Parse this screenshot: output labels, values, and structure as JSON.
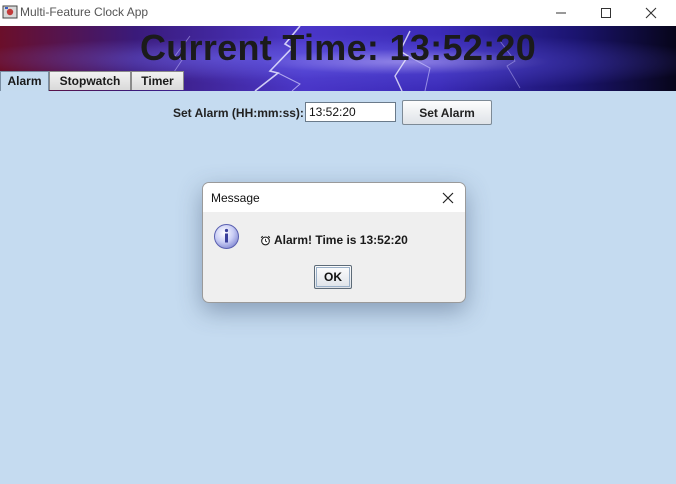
{
  "window": {
    "title": "Multi-Feature Clock App",
    "icons": [
      "app-icon",
      "minimize-icon",
      "maximize-icon",
      "close-icon"
    ]
  },
  "banner": {
    "time_text": "Current Time: 13:52:20",
    "background": "lightning-storm"
  },
  "tabs": [
    {
      "label": "Alarm",
      "active": true
    },
    {
      "label": "Stopwatch",
      "active": false
    },
    {
      "label": "Timer",
      "active": false
    }
  ],
  "alarm": {
    "field_label": "Set Alarm (HH:mm:ss):",
    "time_value": "13:52:20",
    "set_button": "Set Alarm"
  },
  "dialog": {
    "title": "Message",
    "message": "Alarm! Time is 13:52:20",
    "ok_button": "OK",
    "icon": "information-icon"
  },
  "colors": {
    "panel_bg": "#c5dbf0",
    "dialog_bg": "#efefef",
    "banner_text": "#1b1b1b"
  }
}
